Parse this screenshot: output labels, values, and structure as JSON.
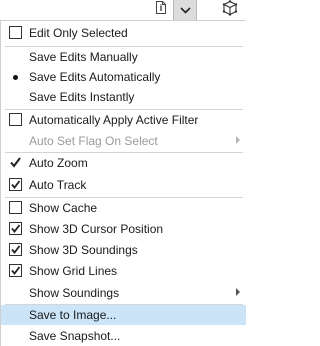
{
  "toolbar": {
    "info_icon": "info-icon",
    "dropdown_icon": "chevron-down-icon",
    "cube_icon": "3d-cube-icon"
  },
  "menu": {
    "items": [
      {
        "label": "Edit Only Selected",
        "type": "checkbox",
        "checked": false,
        "enabled": true
      },
      {
        "label": "Save Edits Manually",
        "type": "radio",
        "checked": false,
        "enabled": true
      },
      {
        "label": "Save Edits Automatically",
        "type": "radio",
        "checked": true,
        "enabled": true
      },
      {
        "label": "Save Edits Instantly",
        "type": "radio",
        "checked": false,
        "enabled": true
      },
      {
        "label": "Automatically Apply Active Filter",
        "type": "checkbox",
        "checked": false,
        "enabled": true
      },
      {
        "label": "Auto Set Flag On Select",
        "type": "submenu",
        "enabled": false
      },
      {
        "label": "Auto Zoom",
        "type": "check",
        "checked": true,
        "enabled": true
      },
      {
        "label": "Auto Track",
        "type": "checkbox",
        "checked": true,
        "enabled": true
      },
      {
        "label": "Show Cache",
        "type": "checkbox",
        "checked": false,
        "enabled": true
      },
      {
        "label": "Show 3D Cursor Position",
        "type": "checkbox",
        "checked": true,
        "enabled": true
      },
      {
        "label": "Show 3D Soundings",
        "type": "checkbox",
        "checked": true,
        "enabled": true
      },
      {
        "label": "Show Grid Lines",
        "type": "checkbox",
        "checked": true,
        "enabled": true
      },
      {
        "label": "Show Soundings",
        "type": "submenu",
        "enabled": true
      },
      {
        "label": "Save to Image...",
        "type": "action",
        "enabled": true,
        "highlighted": true
      },
      {
        "label": "Save Snapshot...",
        "type": "action",
        "enabled": true
      }
    ]
  },
  "colors": {
    "highlight": "#cce4f7",
    "disabled_text": "#9a9a9a",
    "text": "#1a1a1a"
  }
}
